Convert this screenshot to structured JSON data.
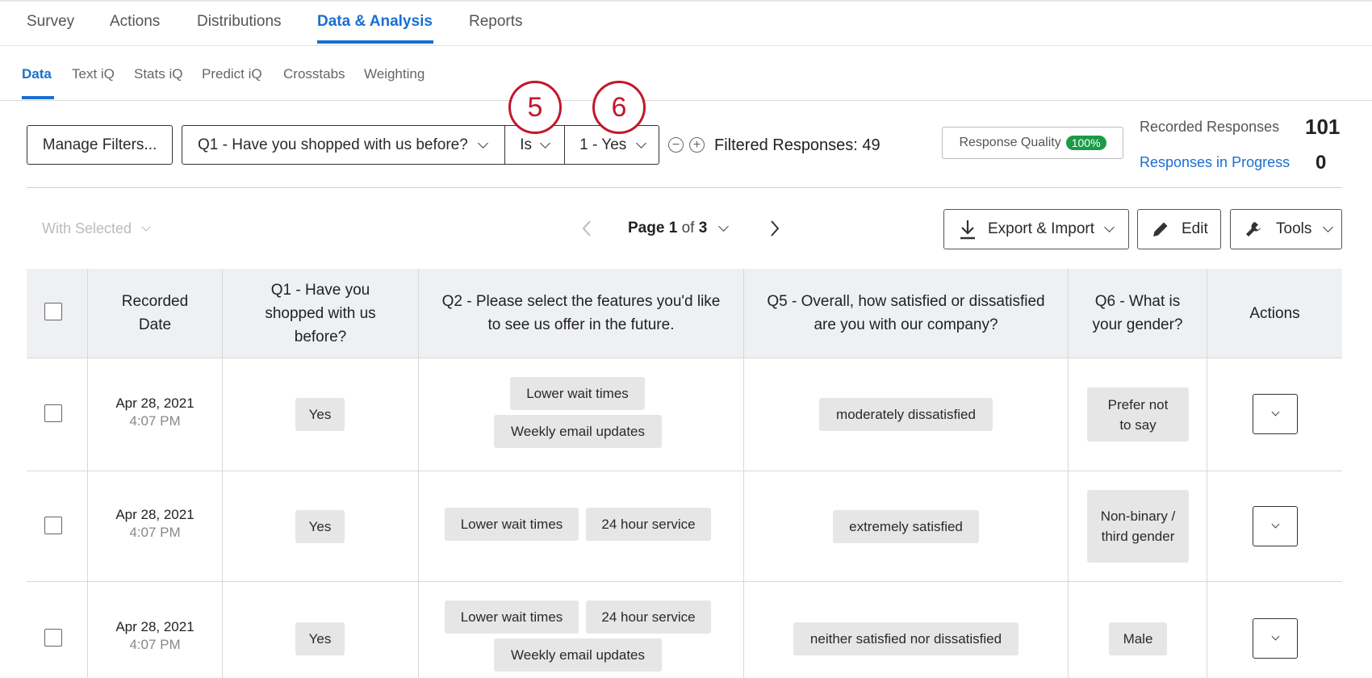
{
  "top_tabs": [
    "Survey",
    "Actions",
    "Distributions",
    "Data & Analysis",
    "Reports"
  ],
  "sub_tabs": [
    "Data",
    "Text iQ",
    "Stats iQ",
    "Predict iQ",
    "Crosstabs",
    "Weighting"
  ],
  "filters": {
    "manage_label": "Manage Filters...",
    "question": "Q1 - Have you shopped with us before?",
    "operator": "Is",
    "value": "1 - Yes",
    "remove_icon": "minus-circle-icon",
    "add_icon": "plus-circle-icon",
    "filtered_label": "Filtered Responses: 49"
  },
  "callouts": [
    "5",
    "6"
  ],
  "response_quality": {
    "label": "Response Quality",
    "badge": "100%"
  },
  "stats": {
    "recorded_label": "Recorded Responses",
    "recorded_value": "101",
    "in_progress_label": "Responses in Progress",
    "in_progress_value": "0"
  },
  "toolbar": {
    "with_selected": "With Selected",
    "page_word": "Page",
    "page_current": "1",
    "page_of": "of",
    "page_total": "3",
    "export_label": "Export & Import",
    "edit_label": "Edit",
    "tools_label": "Tools"
  },
  "table": {
    "headers": [
      "Recorded Date",
      "Q1 - Have you shopped with us before?",
      "Q2 - Please select the features you'd like to see us offer in the future.",
      "Q5 - Overall, how satisfied or dissatisfied are you with our company?",
      "Q6 - What is your gender?",
      "Actions"
    ],
    "rows": [
      {
        "date": "Apr 28, 2021",
        "time": "4:07 PM",
        "q1": "Yes",
        "q2": [
          "Lower wait times",
          "Weekly email updates"
        ],
        "q5": "moderately dissatisfied",
        "q6": "Prefer not to say"
      },
      {
        "date": "Apr 28, 2021",
        "time": "4:07 PM",
        "q1": "Yes",
        "q2": [
          "Lower wait times",
          "24 hour service"
        ],
        "q5": "extremely satisfied",
        "q6": "Non-binary / third gender"
      },
      {
        "date": "Apr 28, 2021",
        "time": "4:07 PM",
        "q1": "Yes",
        "q2": [
          "Lower wait times",
          "24 hour service",
          "Weekly email updates"
        ],
        "q5": "neither satisfied nor dissatisfied",
        "q6": "Male"
      }
    ]
  },
  "colors": {
    "accent": "#1a6fd1",
    "callout": "#c4162c",
    "quality_badge": "#1a9b47"
  }
}
